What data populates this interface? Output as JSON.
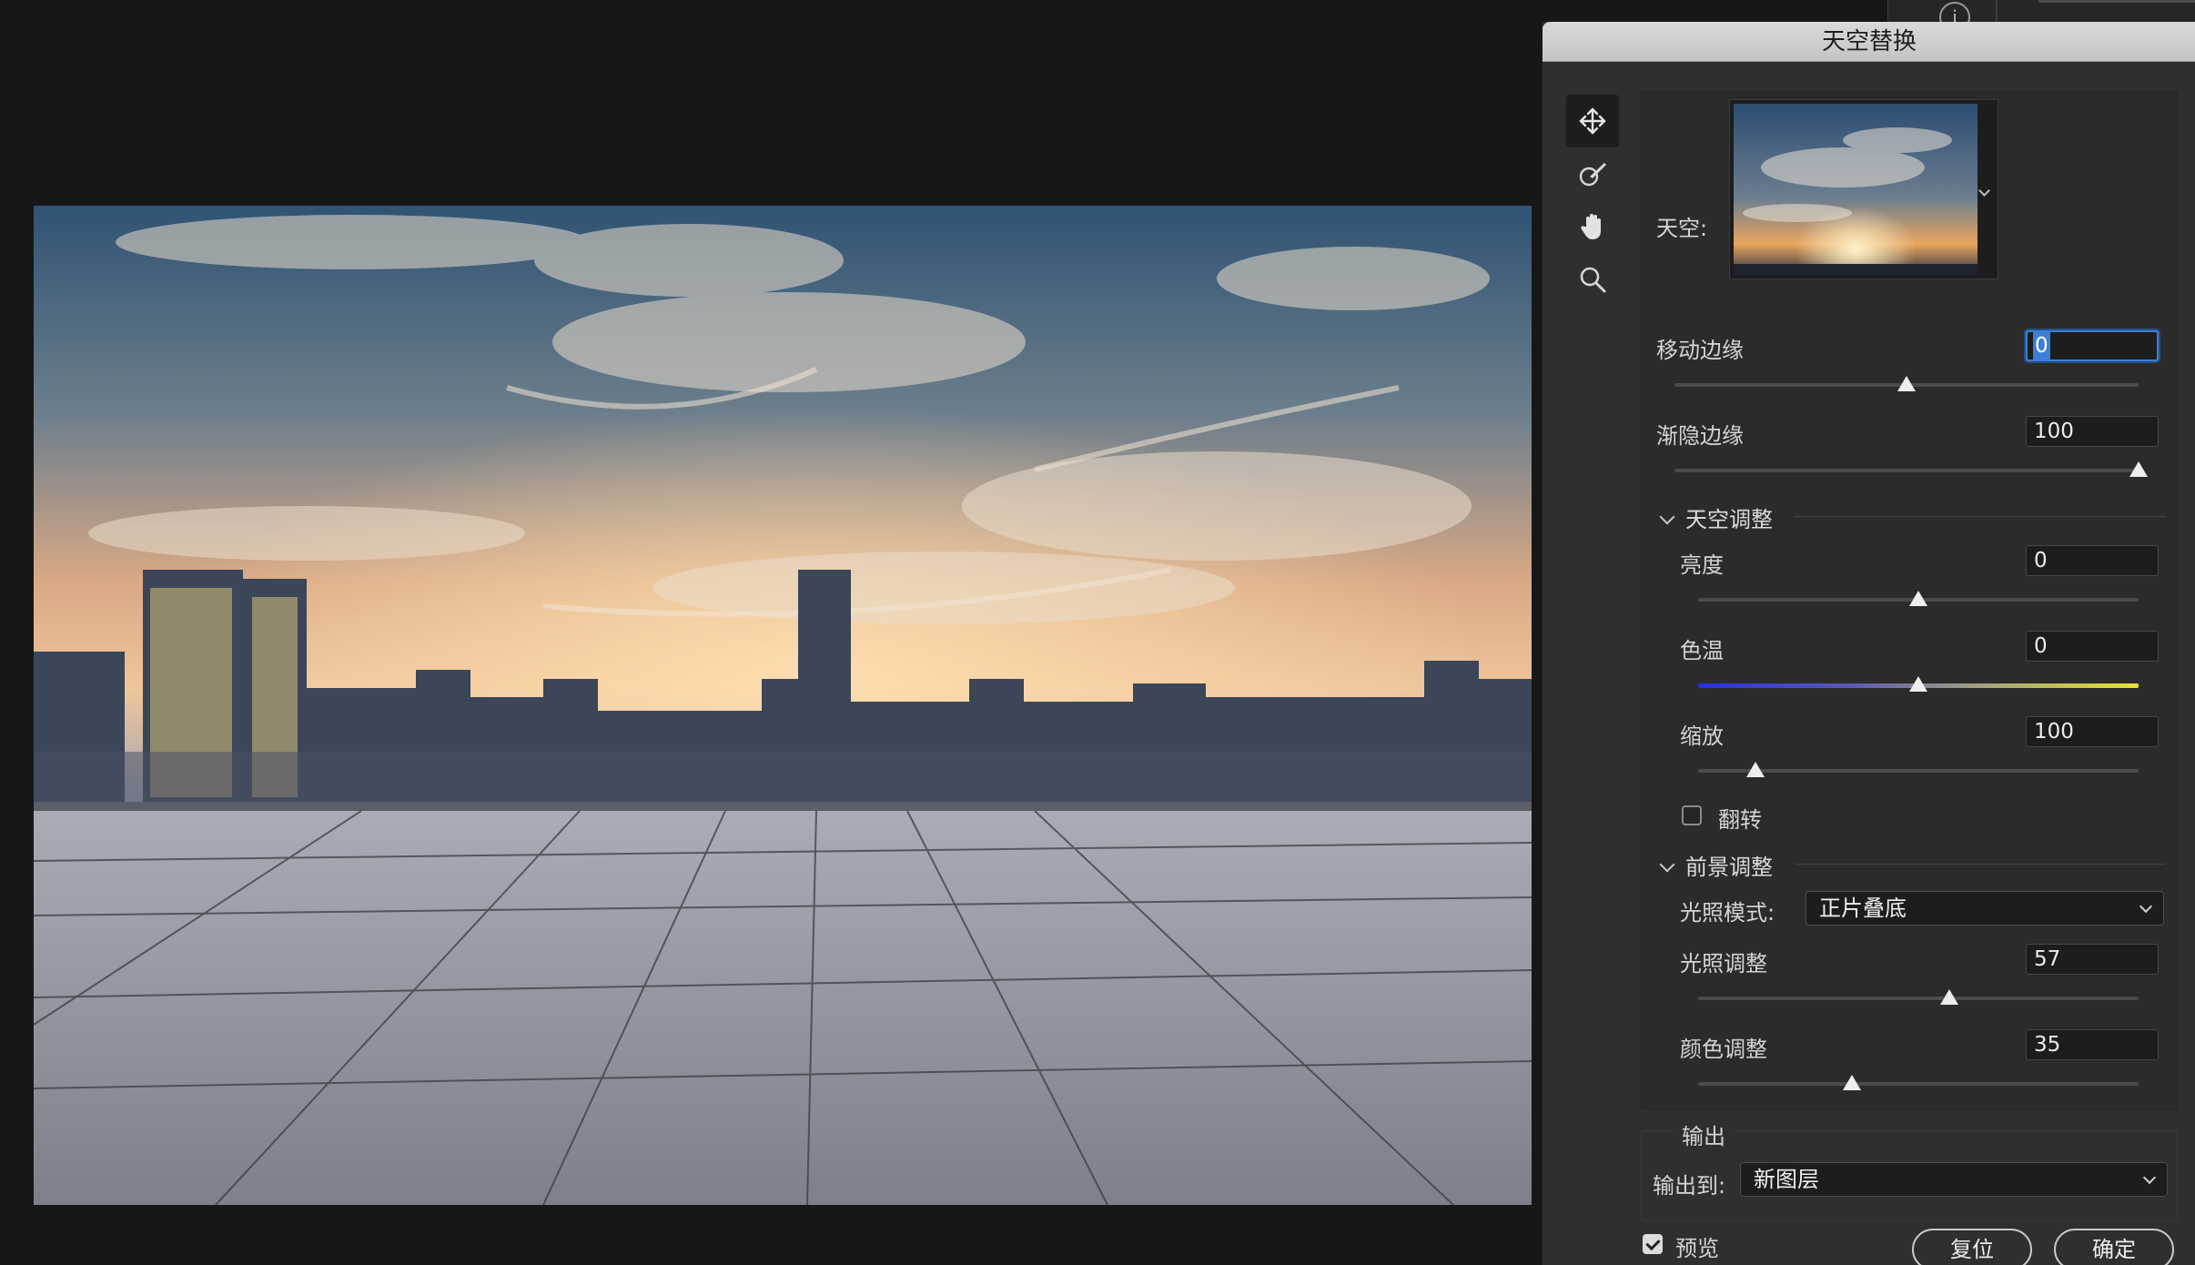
{
  "dialog": {
    "title": "天空替换",
    "tools": [
      {
        "name": "move-sky-tool",
        "icon": "move-icon",
        "active": true
      },
      {
        "name": "sky-brush-tool",
        "icon": "brush-icon",
        "active": false
      },
      {
        "name": "hand-tool",
        "icon": "hand-icon",
        "active": false
      },
      {
        "name": "zoom-tool",
        "icon": "zoom-icon",
        "active": false
      }
    ],
    "sky_label": "天空:",
    "shift_edge": {
      "label": "移动边缘",
      "value": "0",
      "slider_fraction": 0.5
    },
    "fade_edge": {
      "label": "渐隐边缘",
      "value": "100",
      "slider_fraction": 1.0
    },
    "sky_adjustments": {
      "title": "天空调整",
      "brightness": {
        "label": "亮度",
        "value": "0",
        "slider_fraction": 0.5
      },
      "temperature": {
        "label": "色温",
        "value": "0",
        "slider_fraction": 0.5
      },
      "scale": {
        "label": "缩放",
        "value": "100",
        "slider_fraction": 0.13
      },
      "flip": {
        "label": "翻转",
        "checked": false
      }
    },
    "foreground_adjustments": {
      "title": "前景调整",
      "lighting_mode": {
        "label": "光照模式:",
        "value": "正片叠底"
      },
      "lighting_adjust": {
        "label": "光照调整",
        "value": "57",
        "slider_fraction": 0.57
      },
      "color_adjust": {
        "label": "颜色调整",
        "value": "35",
        "slider_fraction": 0.35
      }
    },
    "output": {
      "title": "输出",
      "output_to": {
        "label": "输出到:",
        "value": "新图层"
      }
    },
    "preview": {
      "label": "预览",
      "checked": true
    },
    "reset_label": "复位",
    "ok_label": "确定"
  },
  "top_strip": {
    "info_icon_glyph": "i"
  }
}
